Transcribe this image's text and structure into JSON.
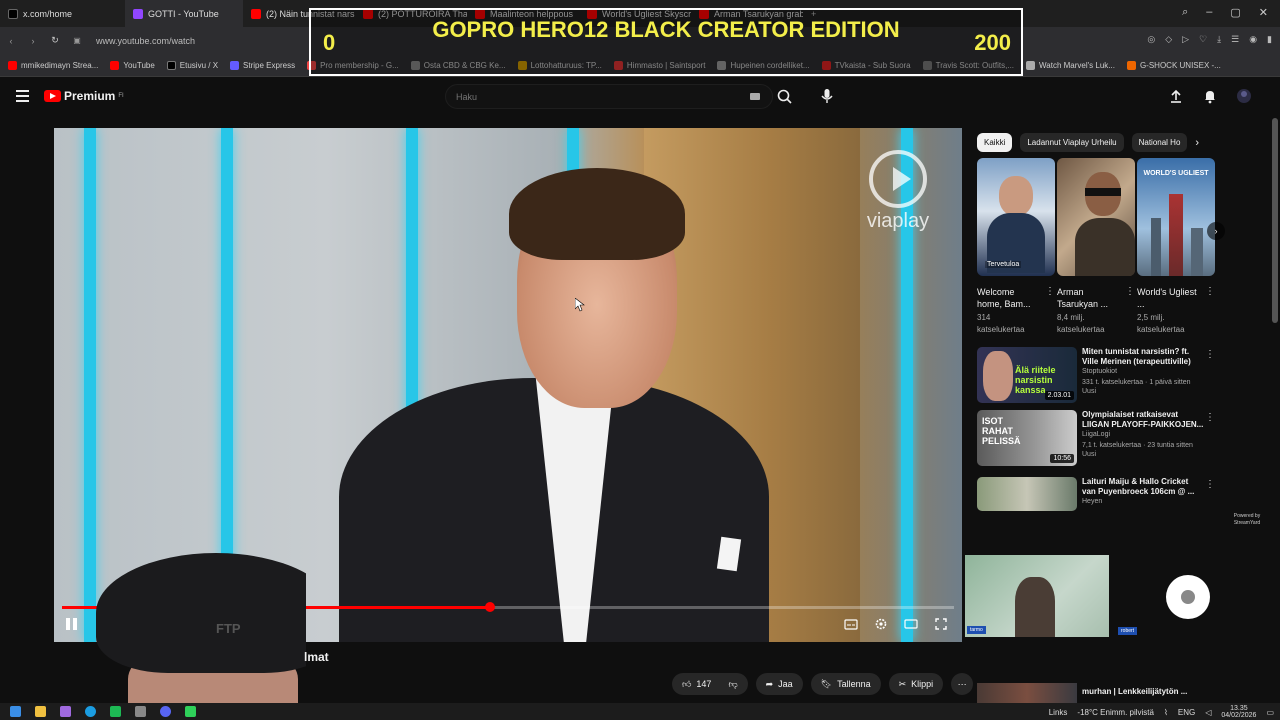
{
  "browser": {
    "tabs": [
      {
        "title": "x.com/home",
        "icon": "x-icon",
        "color": "#000000",
        "active": false
      },
      {
        "title": "GOTTI - YouTube",
        "icon": "twitch-icon",
        "color": "#9146ff",
        "active": true
      },
      {
        "title": "(2) Näin tunnistat narsistin",
        "icon": "youtube-icon",
        "color": "#ff0000",
        "active": false
      },
      {
        "title": "(2) POTTUROIRA Thaimaa",
        "icon": "youtube-icon",
        "color": "#ff0000",
        "active": false
      },
      {
        "title": "Maalinteon helppous",
        "icon": "youtube-icon",
        "color": "#ff0000",
        "active": false
      },
      {
        "title": "World's Ugliest Skyscraper",
        "icon": "youtube-icon",
        "color": "#ff0000",
        "active": false
      },
      {
        "title": "Arman Tsarukyan grabs the",
        "icon": "youtube-icon",
        "color": "#ff0000",
        "active": false
      }
    ],
    "url": "www.youtube.com/watch",
    "bookmarks": [
      "mmikedimayn Strea...",
      "YouTube",
      "Etusivu / X",
      "Stripe Express",
      "Pro membership - G...",
      "Osta CBD & CBG Ke...",
      "Lottohatturuus: TP...",
      "Himmasto | Saintsport",
      "Hupeinen cordelliket...",
      "TVkaista - Sub Suora",
      "Travis Scott: Outfits,...",
      "Watch Marvel's Luk...",
      "G-SHOCK UNISEX -..."
    ]
  },
  "overlay": {
    "left_value": "0",
    "title": "GOPRO HERO12 BLACK CREATOR EDITION",
    "right_value": "200"
  },
  "youtube": {
    "brand": "Premium",
    "brand_suffix": "FI",
    "search_placeholder": "Haku",
    "player": {
      "watermark": "viaplay",
      "progress_fraction": 0.48
    },
    "title_fragment": "lmat",
    "actions": {
      "likes": "147",
      "share": "Jaa",
      "save": "Tallenna",
      "clip": "Klippi"
    }
  },
  "sidebar": {
    "chips": [
      "Kaikki",
      "Ladannut Viaplay Urheilu",
      "National Ho"
    ],
    "shorts": [
      {
        "title": "Welcome home, Bam...",
        "views": "314",
        "views_suffix": "katselukertaa",
        "thumb_text": "Tervetuloa"
      },
      {
        "title": "Arman Tsarukyan ...",
        "views": "8,4 milj.",
        "views_suffix": "katselukertaa",
        "thumb_text": ""
      },
      {
        "title": "World's Ugliest ...",
        "views": "2,5 milj.",
        "views_suffix": "katselukertaa",
        "thumb_text": "WORLD'S UGLIEST"
      }
    ],
    "recommendations": [
      {
        "title": "Miten tunnistat narsistin? ft. Ville Merinen (terapeuttiville)",
        "channel": "Stoptuokiot",
        "meta": "331 t. katselukertaa · 1 päivä sitten",
        "badge": "Uusi",
        "duration": "2.03.01",
        "thumb_text": "Älä riitele narsistin kanssa"
      },
      {
        "title": "Olympialaiset ratkaisevat LIIGAN PLAYOFF-PAIKKOJEN...",
        "channel": "LiigaLogi",
        "meta": "7,1 t. katselukertaa · 23 tuntia sitten",
        "badge": "Uusi",
        "duration": "10:56",
        "thumb_text": "ISOT RAHAT PELISSÄ"
      },
      {
        "title": "Laituri Maiju & Hallo Cricket van Puyenbroeck 106cm @ ...",
        "channel": "Heyen",
        "meta": "",
        "badge": "",
        "duration": "",
        "thumb_text": ""
      }
    ],
    "bottom_rec_title": "murhan | Lenkkeilijätytön ...",
    "streamyard": "Powered by StreamYard",
    "cam_tag_1": "tarmo",
    "cam_tag_2": "robert"
  },
  "taskbar": {
    "links": "Links",
    "weather": "-18°C  Enimm. pilvistä",
    "lang": "ENG",
    "time": "13.35",
    "date": "04/02/2026"
  }
}
